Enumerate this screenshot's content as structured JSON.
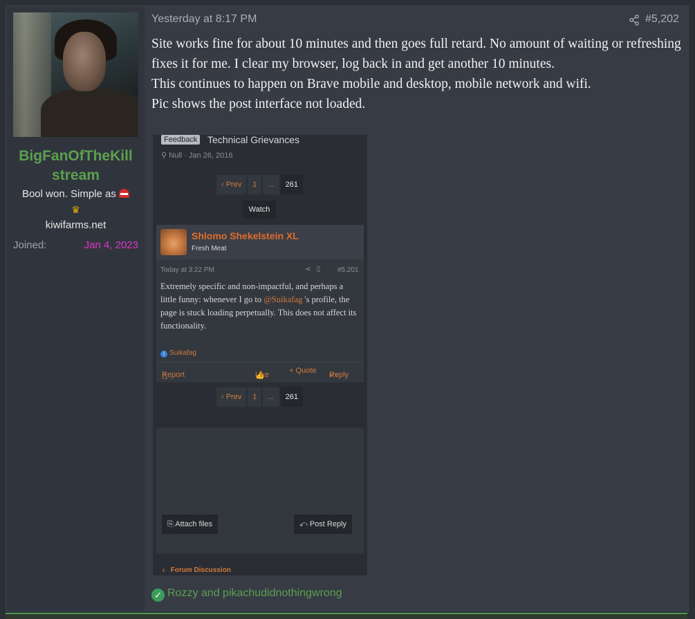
{
  "user": {
    "name": "BigFanOfTheKillstream",
    "name_line1": "BigFanOfTheKill",
    "name_line2": "stream",
    "title_text": "Bool won. Simple as",
    "site": "kiwifarms.net",
    "joined_label": "Joined:",
    "joined_date": "Jan 4, 2023",
    "username_color": "#5ca04f",
    "joined_date_color": "#e233c9"
  },
  "post": {
    "date": "Yesterday at 8:17 PM",
    "number": "#5,202",
    "paragraphs": [
      "Site works fine for about 10 minutes and then goes full retard. No amount of waiting or refreshing fixes it for me. I clear my browser, log back in and get another 10 minutes.",
      "This continues to happen on Brave mobile and desktop, mobile network and wifi.",
      "Pic shows the post interface not loaded."
    ],
    "reactions_text": "Rozzy and pikachudidnothingwrong"
  },
  "screenshot": {
    "tag": "Feedback",
    "thread_title": "Technical Grievances",
    "meta": "Null · Jan 26, 2016",
    "pager": {
      "prev": "‹ Prev",
      "first": "1",
      "ellipsis": "...",
      "current": "261"
    },
    "watch": "Watch",
    "inner_post": {
      "author": "Shlomo Shekelstein XL",
      "rank": "Fresh Meat",
      "date": "Today at 3:22 PM",
      "number": "#5,201",
      "text_before": "Extremely specific and non-impactful, and perhaps a little funny: whenever I go to ",
      "mention": "@Suikafag",
      "text_after": " 's profile, the page is stuck loading perpetually. This does not affect its functionality.",
      "reaction_user": "Suikafag",
      "report": "Report",
      "like": "Like",
      "quote": "+ Quote",
      "reply": "Reply"
    },
    "attach_files": "Attach files",
    "post_reply": "Post Reply",
    "forum_link": "Forum Discussion",
    "accent_color": "#d07b3c"
  }
}
